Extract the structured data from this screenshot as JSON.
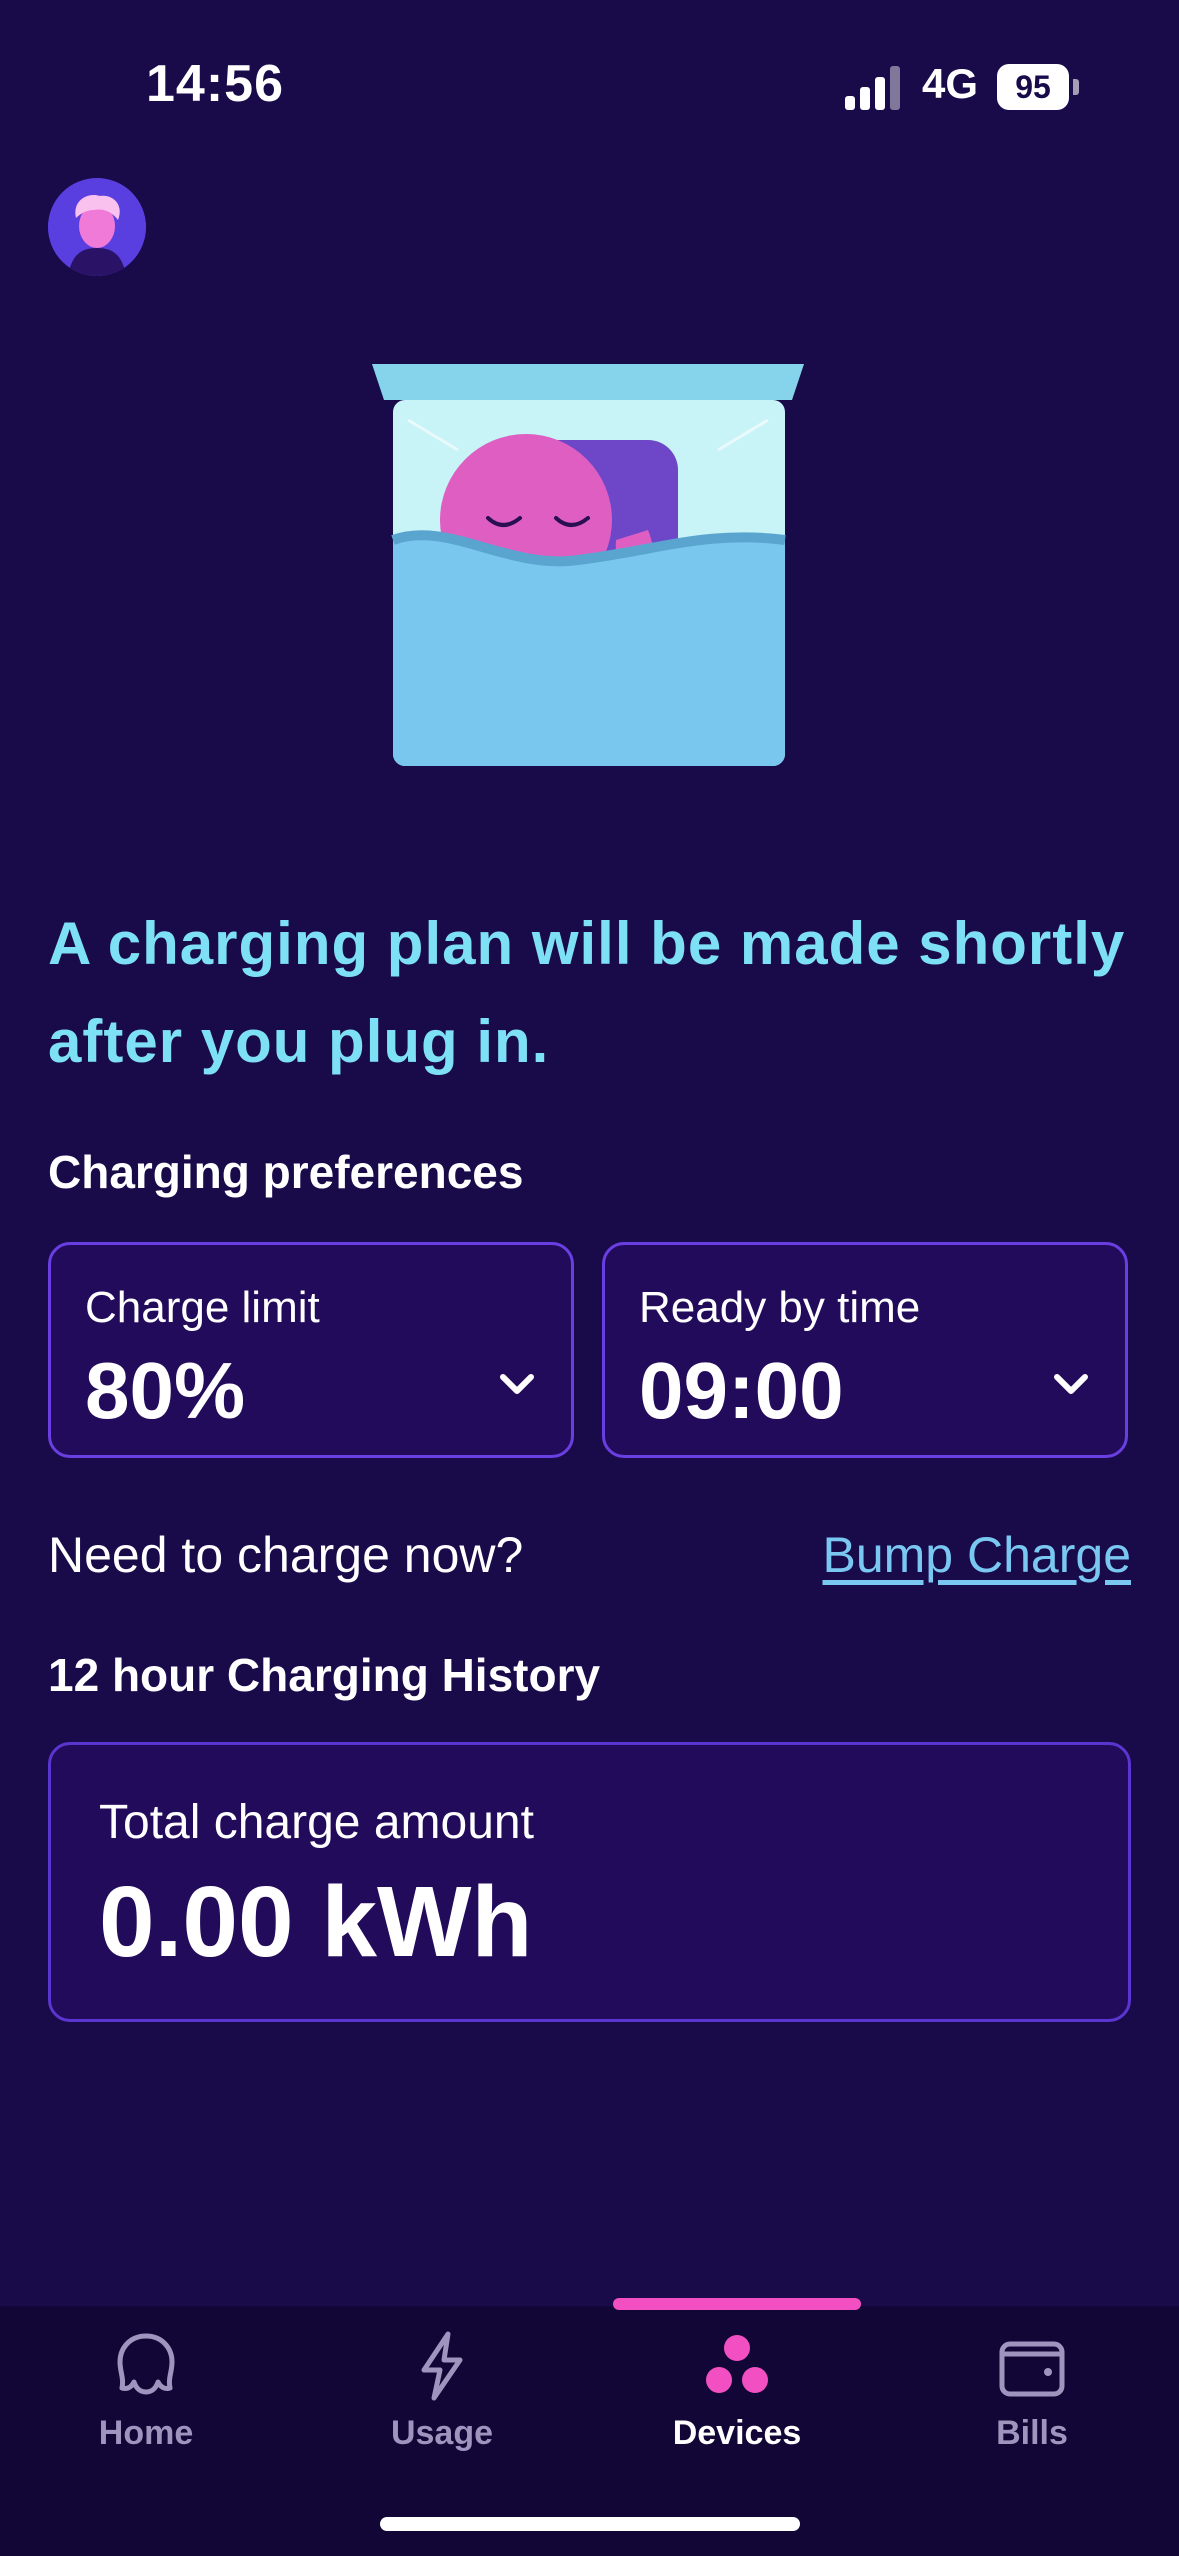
{
  "status_bar": {
    "time": "14:56",
    "network": "4G",
    "battery": "95"
  },
  "headline": "A charging plan will be made shortly after you plug in.",
  "preferences": {
    "title": "Charging preferences",
    "charge_limit": {
      "label": "Charge limit",
      "value": "80%"
    },
    "ready_by": {
      "label": "Ready by time",
      "value": "09:00"
    }
  },
  "charge_now": {
    "question": "Need to charge now?",
    "link": "Bump Charge"
  },
  "history": {
    "title": "12 hour Charging History",
    "label": "Total charge amount",
    "value": "0.00 kWh"
  },
  "tabs": [
    {
      "label": "Home",
      "icon": "octopus-icon",
      "active": false
    },
    {
      "label": "Usage",
      "icon": "lightning-icon",
      "active": false
    },
    {
      "label": "Devices",
      "icon": "devices-icon",
      "active": true
    },
    {
      "label": "Bills",
      "icon": "wallet-icon",
      "active": false
    }
  ],
  "colors": {
    "background": "#190a4a",
    "headline": "#7ee0f4",
    "card_border": "#6a3fe2",
    "link": "#7ac8f2",
    "tab_active_indicator": "#f24fc2"
  }
}
